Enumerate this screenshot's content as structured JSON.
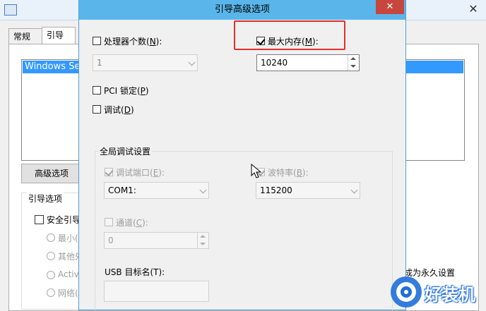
{
  "background_window": {
    "tabs": [
      {
        "label": "常规"
      },
      {
        "label": "引导"
      }
    ],
    "boot_list": {
      "selected_entry": "Windows Ser"
    },
    "advanced_button_label": "高级选项",
    "boot_options_group": {
      "title": "引导选项",
      "safe_boot_label": "安全引导",
      "radio_items": [
        "最小(",
        "其他外",
        "Activ",
        "网络("
      ]
    },
    "persist_text": "成为永久设置"
  },
  "dialog": {
    "title": "引导高级选项",
    "close_glyph": "✕",
    "processor_count": {
      "label_prefix": "处理器个数(",
      "label_key": "N",
      "label_suffix": "):",
      "checked": false,
      "value": "1"
    },
    "max_memory": {
      "label_prefix": "最大内存(",
      "label_key": "M",
      "label_suffix": "):",
      "checked": true,
      "value": "10240"
    },
    "pci_lock": {
      "label_prefix": "PCI 锁定(",
      "label_key": "P",
      "label_suffix": ")",
      "checked": false
    },
    "debug": {
      "label_prefix": "调试(",
      "label_key": "D",
      "label_suffix": ")",
      "checked": false
    },
    "global_debug_settings": {
      "title": "全局调试设置",
      "debug_port": {
        "label_prefix": "调试端口(",
        "label_key": "E",
        "label_suffix": "):",
        "checked": true,
        "value": "COM1:"
      },
      "baud_rate": {
        "label_prefix": "波特率(",
        "label_key": "B",
        "label_suffix": "):",
        "checked": true,
        "value": "115200"
      },
      "channel": {
        "label_prefix": "通道(",
        "label_key": "C",
        "label_suffix": "):",
        "checked": false,
        "value": "0"
      },
      "usb_target_label": "USB 目标名(T):",
      "usb_target_value": ""
    }
  },
  "watermark": {
    "text": "好装机",
    "accent_color": "#1e6fd9"
  },
  "colors": {
    "dialog_titlebar": "#5ab6ea",
    "close_button": "#c7473e",
    "highlight_box": "#e0302a",
    "list_selection": "#3399ff"
  }
}
